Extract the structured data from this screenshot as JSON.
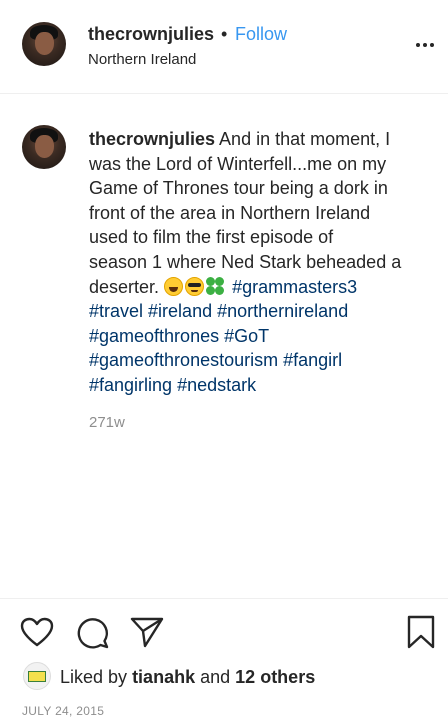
{
  "header": {
    "username": "thecrownjulies",
    "separator": "•",
    "follow_label": "Follow",
    "location": "Northern Ireland"
  },
  "caption": {
    "username": "thecrownjulies",
    "lines": [
      "And in that moment, I",
      "was the Lord of Winterfell...me on my",
      "Game of Thrones tour being a dork in",
      "front of the area in Northern Ireland",
      "used to film the first episode of",
      "season 1 where Ned Stark beheaded a",
      "deserter."
    ],
    "emojis": [
      "laughing-emoji",
      "sunglasses-emoji",
      "four-leaf-clover-emoji"
    ],
    "hashtags": [
      "#grammasters3",
      "#travel",
      "#ireland",
      "#northernireland",
      "#gameofthrones",
      "#GoT",
      "#gameofthronestourism",
      "#fangirl",
      "#fangirling",
      "#nedstark"
    ],
    "time_ago": "271w"
  },
  "actions": {
    "icons": [
      "heart-icon",
      "comment-icon",
      "share-icon",
      "bookmark-icon"
    ]
  },
  "likes": {
    "prefix": "Liked by",
    "user": "tianahk",
    "joiner": "and",
    "others": "12 others"
  },
  "date": "JULY 24, 2015",
  "colors": {
    "link": "#3897f0",
    "hashtag": "#003569",
    "muted": "#8e8e8e",
    "text": "#262626",
    "divider": "#efefef"
  }
}
